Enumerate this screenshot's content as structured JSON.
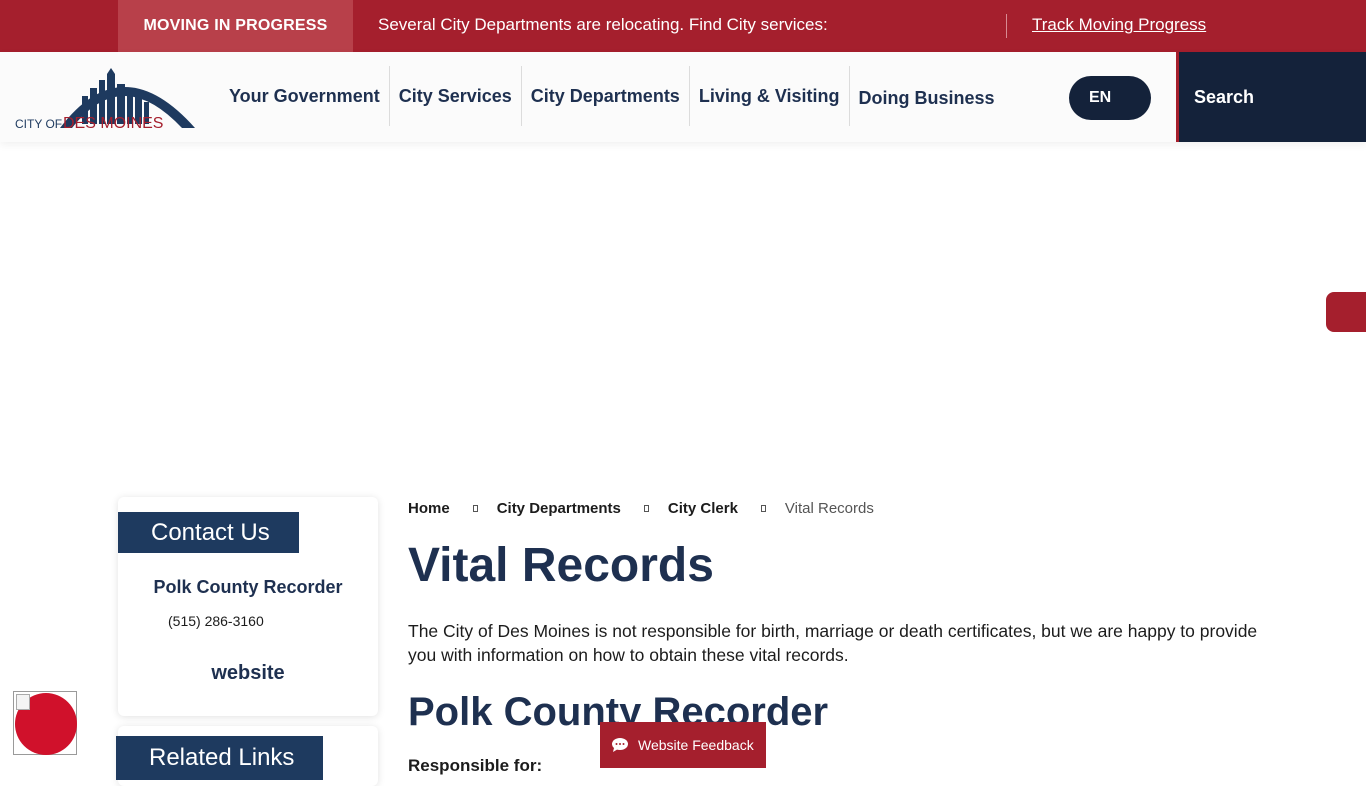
{
  "alert": {
    "tag": "MOVING IN PROGRESS",
    "message": "Several City Departments are relocating. Find City services:",
    "link": "Track Moving Progress"
  },
  "header": {
    "logo_text_small": "CITY OF",
    "logo_text_main": "DES MOINES",
    "nav": [
      {
        "label": "Your Government"
      },
      {
        "label": "City Services"
      },
      {
        "label": "City Departments"
      },
      {
        "label": "Living & Visiting"
      },
      {
        "label": "Doing Business"
      }
    ],
    "language": "EN",
    "search_label": "Search"
  },
  "sidebar": {
    "contact_heading": "Contact Us",
    "contact_name": "Polk County Recorder",
    "contact_phone": "(515) 286-3160",
    "contact_website": "website",
    "related_heading": "Related Links"
  },
  "breadcrumb": {
    "items": [
      "Home",
      "City Departments",
      "City Clerk"
    ],
    "current": "Vital Records"
  },
  "main": {
    "title": "Vital Records",
    "intro": "The City of Des Moines is not responsible for birth, marriage or death certificates, but we are happy to provide you with information on how to obtain these vital records.",
    "section_title": "Polk County Recorder",
    "responsible_label": "Responsible for:"
  },
  "feedback": {
    "label": "Website Feedback"
  },
  "colors": {
    "brand_red": "#a51f2d",
    "navy": "#14223a",
    "heading_blue": "#1e3050"
  }
}
